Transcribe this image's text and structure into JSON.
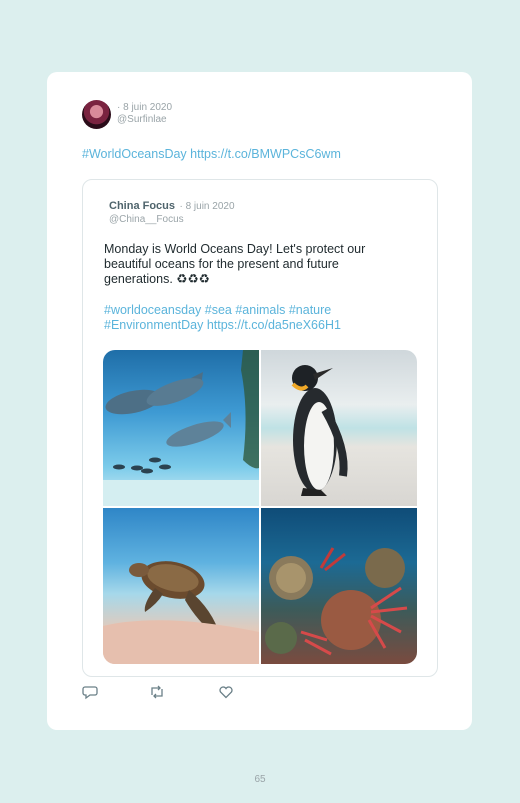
{
  "tweet": {
    "date": "· 8 juin 2020",
    "handle": "@Surfinlae",
    "text": "#WorldOceansDay https://t.co/BMWPCsC6wm"
  },
  "quote": {
    "name": "China Focus",
    "date": "· 8 juin 2020",
    "handle": "@China__Focus",
    "body": "Monday is World Oceans Day! Let's protect our beautiful oceans for the present and future generations. ♻♻♻",
    "hashtags_line1": "#worldoceansday #sea #animals #nature",
    "hashtags_line2": "#EnvironmentDay https://t.co/da5neX66H1",
    "images": [
      {
        "subject": "whales"
      },
      {
        "subject": "penguin"
      },
      {
        "subject": "sea-turtle"
      },
      {
        "subject": "coral-reef"
      }
    ]
  },
  "actions": [
    {
      "icon": "reply-icon"
    },
    {
      "icon": "retweet-icon"
    },
    {
      "icon": "like-icon"
    }
  ],
  "page_number": "65"
}
